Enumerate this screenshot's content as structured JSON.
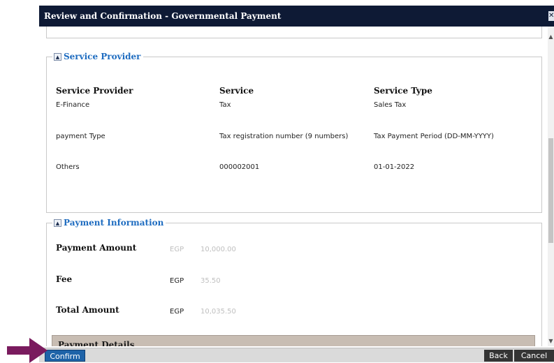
{
  "dialog": {
    "title": "Review and Confirmation - Governmental Payment",
    "close_glyph": "✕"
  },
  "service_provider": {
    "legend": "Service Provider",
    "headers": [
      "Service Provider",
      "Service",
      "Service Type"
    ],
    "row1": [
      "E-Finance",
      "Tax",
      "Sales Tax"
    ],
    "row2": [
      "payment Type",
      "Tax registration number (9 numbers)",
      "Tax Payment Period (DD-MM-YYYY)"
    ],
    "row3": [
      "Others",
      "000002001",
      "01-01-2022"
    ]
  },
  "payment_information": {
    "legend": "Payment Information",
    "payment_amount": {
      "label": "Payment Amount",
      "currency": "EGP",
      "amount": "10,000.00"
    },
    "fee": {
      "label": "Fee",
      "currency": "EGP",
      "amount": "35.50"
    },
    "total_amount": {
      "label": "Total Amount",
      "currency": "EGP",
      "amount": "10,035.50"
    }
  },
  "payment_details": {
    "label": "Payment Details"
  },
  "footer": {
    "confirm_label": "Confirm",
    "back_label": "Back",
    "cancel_label": "Cancel"
  },
  "icons": {
    "collapse": "▲",
    "scroll_up": "▲",
    "scroll_down": "▼",
    "pointer": "arrow-right-icon"
  },
  "colors": {
    "titlebar_bg": "#0e1a35",
    "legend_text": "#1e6cc0",
    "confirm_bg": "#1e63a8",
    "pointer": "#7a1b5e",
    "details_bar": "#c8bdb3"
  }
}
